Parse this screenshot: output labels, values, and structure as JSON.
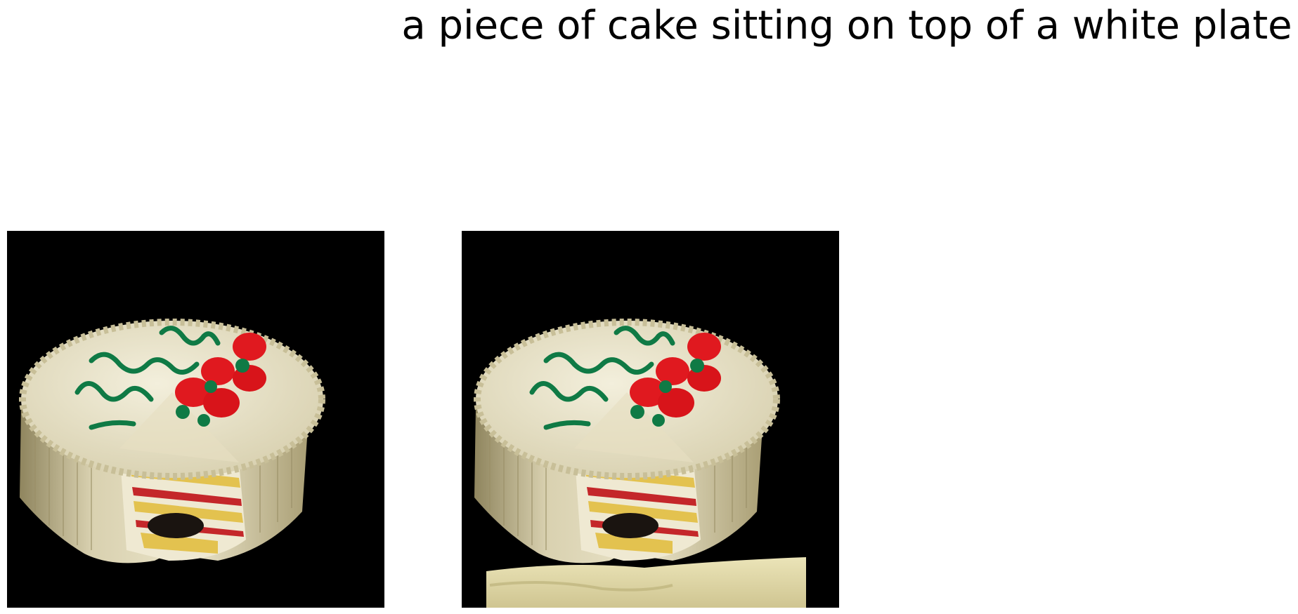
{
  "caption": "a piece of cake sitting on top of a white plate",
  "panels": [
    {
      "name": "original-image",
      "background": "#000000",
      "has_plate": false
    },
    {
      "name": "edited-image",
      "background": "#000000",
      "has_plate": true
    }
  ],
  "cake_text": [
    "Happy",
    "Birthday",
    "Joan"
  ],
  "colors": {
    "background": "#000000",
    "frosting": "#e9e3c8",
    "frosting_shadow": "#b5aa82",
    "icing_script": "#0f7a45",
    "rose": "#e0191f",
    "cake_sponge": "#e3c24f",
    "jam": "#c4272a",
    "plate": "#ddd6a2"
  }
}
